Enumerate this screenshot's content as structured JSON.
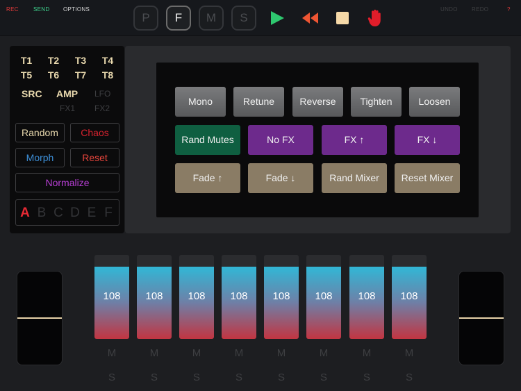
{
  "top_menu": {
    "rec": "REC",
    "send": "SEND",
    "options": "OPTIONS",
    "undo": "UNDO",
    "redo": "REDO",
    "help": "?"
  },
  "modes": [
    "P",
    "F",
    "M",
    "S"
  ],
  "active_mode": "F",
  "transport": {
    "play_icon": "play-icon",
    "rewind_icon": "rewind-icon",
    "stop_icon": "stop-icon",
    "panic_icon": "hand-stop-icon"
  },
  "colors": {
    "rec": "#e23a3a",
    "send": "#3fd48e",
    "play": "#2ec86f",
    "rewind": "#ee5533",
    "stop": "#f6d9a8",
    "panic": "#e11d2a",
    "accent_tan": "#e9d9ae"
  },
  "tracks": [
    "T1",
    "T2",
    "T3",
    "T4",
    "T5",
    "T6",
    "T7",
    "T8"
  ],
  "sources": {
    "src": "SRC",
    "amp": "AMP",
    "lfo": "LFO",
    "fx1": "FX1",
    "fx2": "FX2"
  },
  "pattern_buttons": {
    "random": "Random",
    "chaos": "Chaos",
    "morph": "Morph",
    "reset": "Reset",
    "normalize": "Normalize"
  },
  "slots": [
    "A",
    "B",
    "C",
    "D",
    "E",
    "F"
  ],
  "active_slot": "A",
  "fx_row1": [
    "Mono",
    "Retune",
    "Reverse",
    "Tighten",
    "Loosen"
  ],
  "fx_row2": [
    "Rand Mutes",
    "No FX",
    "FX ↑",
    "FX ↓"
  ],
  "fx_row3": [
    "Fade ↑",
    "Fade ↓",
    "Rand Mixer",
    "Reset Mixer"
  ],
  "faders": [
    {
      "value": "108",
      "level": 0.86,
      "mute": "M",
      "solo": "S"
    },
    {
      "value": "108",
      "level": 0.86,
      "mute": "M",
      "solo": "S"
    },
    {
      "value": "108",
      "level": 0.86,
      "mute": "M",
      "solo": "S"
    },
    {
      "value": "108",
      "level": 0.86,
      "mute": "M",
      "solo": "S"
    },
    {
      "value": "108",
      "level": 0.86,
      "mute": "M",
      "solo": "S"
    },
    {
      "value": "108",
      "level": 0.86,
      "mute": "M",
      "solo": "S"
    },
    {
      "value": "108",
      "level": 0.86,
      "mute": "M",
      "solo": "S"
    },
    {
      "value": "108",
      "level": 0.86,
      "mute": "M",
      "solo": "S"
    }
  ],
  "side_levels": {
    "left": 0.5,
    "right": 0.5
  }
}
